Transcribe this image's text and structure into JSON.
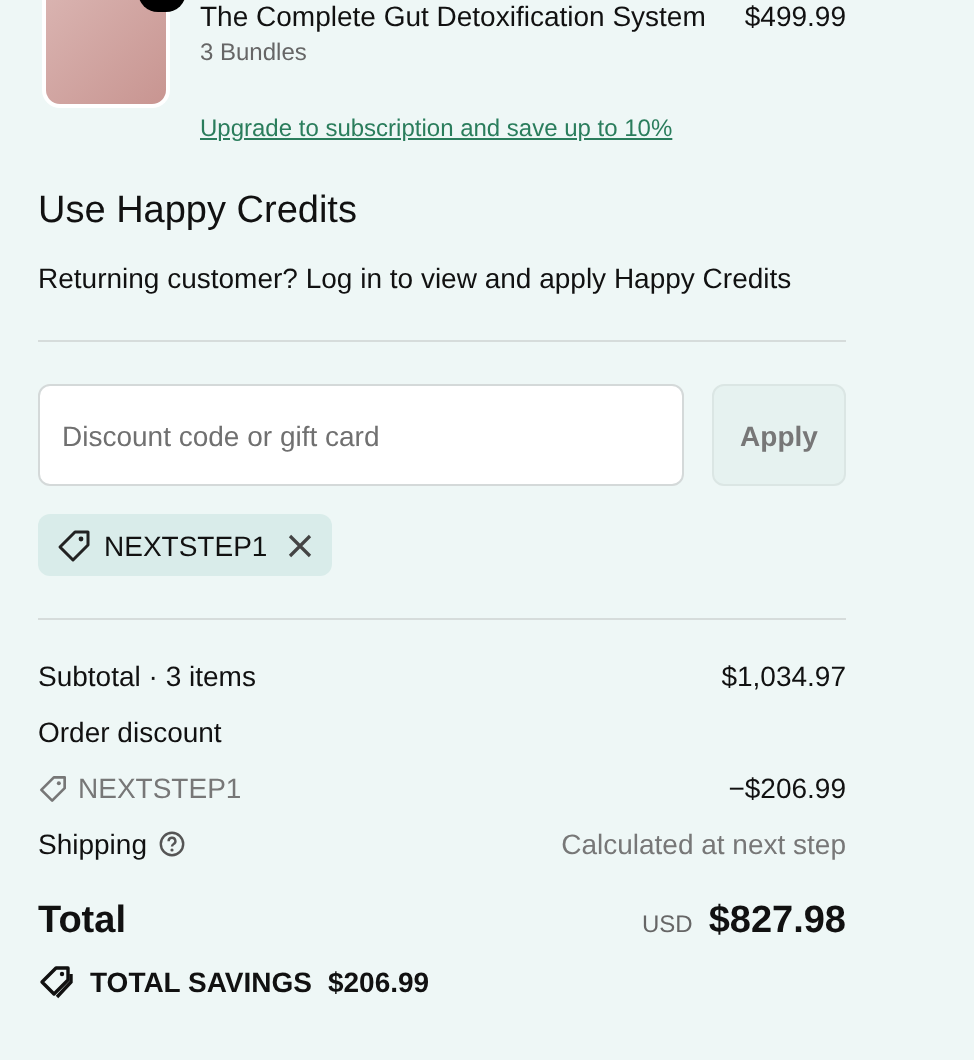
{
  "product": {
    "title": "The Complete Gut Detoxification System",
    "price": "$499.99",
    "variant": "3 Bundles",
    "upgrade_link": "Upgrade to subscription and save up to 10%"
  },
  "credits": {
    "heading": "Use Happy Credits",
    "text": "Returning customer? Log in to view and apply Happy Credits"
  },
  "discount": {
    "placeholder": "Discount code or gift card",
    "button": "Apply",
    "disabled": true,
    "applied_codes": [
      "NEXTSTEP1"
    ]
  },
  "summary": {
    "subtotal_label": "Subtotal · 3 items",
    "subtotal": "$1,034.97",
    "discount_label": "Order discount",
    "discount_code": "NEXTSTEP1",
    "discount_amount": "−$206.99",
    "shipping_label": "Shipping",
    "shipping_value": "Calculated at next step",
    "total_label": "Total",
    "currency": "USD",
    "total": "$827.98",
    "savings_label": "TOTAL SAVINGS",
    "savings": "$206.99"
  }
}
